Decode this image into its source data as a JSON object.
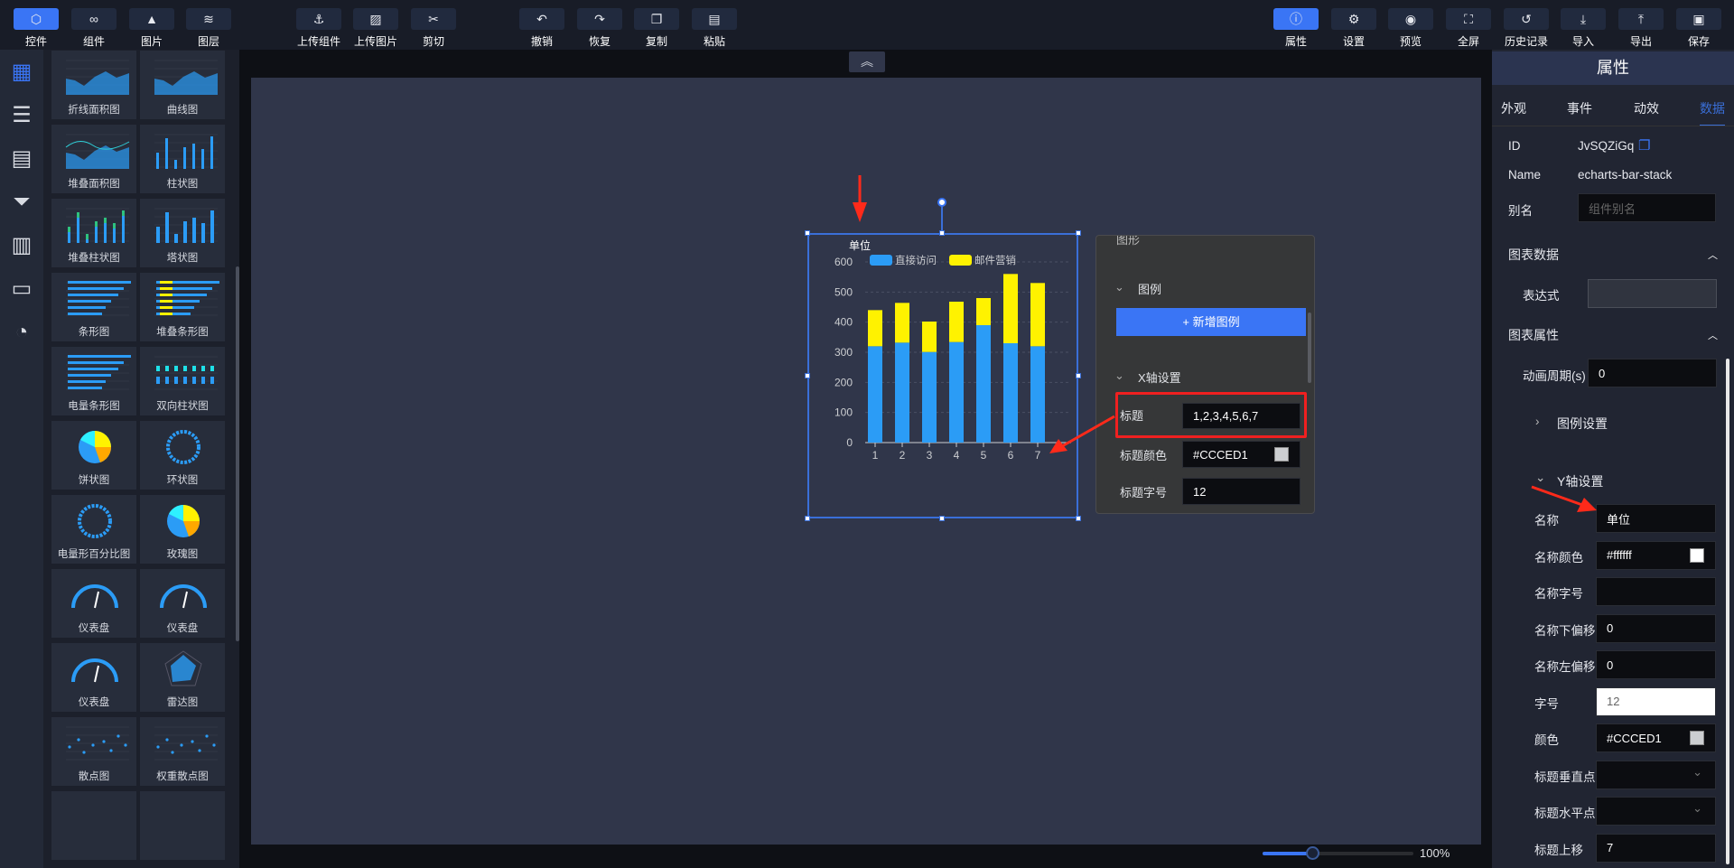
{
  "toolbar": {
    "left": [
      {
        "label": "控件",
        "icon": "⬡",
        "name": "controls",
        "active": true
      },
      {
        "label": "组件",
        "icon": "∞",
        "name": "components"
      },
      {
        "label": "图片",
        "icon": "▲",
        "name": "images"
      },
      {
        "label": "图层",
        "icon": "≋",
        "name": "layers"
      },
      {
        "label": "上传组件",
        "icon": "⚓",
        "name": "upload-component"
      },
      {
        "label": "上传图片",
        "icon": "▨",
        "name": "upload-image"
      },
      {
        "label": "剪切",
        "icon": "✂",
        "name": "cut"
      },
      {
        "label": "撤销",
        "icon": "↶",
        "name": "undo"
      },
      {
        "label": "恢复",
        "icon": "↷",
        "name": "redo"
      },
      {
        "label": "复制",
        "icon": "❐",
        "name": "copy"
      },
      {
        "label": "粘贴",
        "icon": "▤",
        "name": "paste"
      }
    ],
    "right": [
      {
        "label": "属性",
        "icon": "ⓘ",
        "name": "properties",
        "active": true
      },
      {
        "label": "设置",
        "icon": "⚙",
        "name": "settings"
      },
      {
        "label": "预览",
        "icon": "◉",
        "name": "preview"
      },
      {
        "label": "全屏",
        "icon": "⛶",
        "name": "fullscreen"
      },
      {
        "label": "历史记录",
        "icon": "↺",
        "name": "history"
      },
      {
        "label": "导入",
        "icon": "⤓",
        "name": "import"
      },
      {
        "label": "导出",
        "icon": "⤒",
        "name": "export"
      },
      {
        "label": "保存",
        "icon": "▣",
        "name": "save"
      }
    ]
  },
  "rail": [
    {
      "icon": "▦",
      "name": "grid"
    },
    {
      "icon": "☰",
      "name": "sliders"
    },
    {
      "icon": "▤",
      "name": "table"
    },
    {
      "icon": "⏷",
      "name": "filter"
    },
    {
      "icon": "▥",
      "name": "bar-chart"
    },
    {
      "icon": "▭",
      "name": "video"
    },
    {
      "icon": "◔",
      "name": "pie-chart"
    }
  ],
  "components": [
    {
      "label": "折线面积图",
      "kind": "area"
    },
    {
      "label": "曲线图",
      "kind": "area"
    },
    {
      "label": "堆叠面积图",
      "kind": "area2"
    },
    {
      "label": "柱状图",
      "kind": "bar"
    },
    {
      "label": "堆叠柱状图",
      "kind": "stackbar"
    },
    {
      "label": "塔状图",
      "kind": "tower"
    },
    {
      "label": "条形图",
      "kind": "hbar"
    },
    {
      "label": "堆叠条形图",
      "kind": "hstack"
    },
    {
      "label": "电量条形图",
      "kind": "hbar"
    },
    {
      "label": "双向柱状图",
      "kind": "bibar"
    },
    {
      "label": "饼状图",
      "kind": "pie"
    },
    {
      "label": "环状图",
      "kind": "ring"
    },
    {
      "label": "电量形百分比图",
      "kind": "ring"
    },
    {
      "label": "玫瑰图",
      "kind": "pie"
    },
    {
      "label": "仪表盘",
      "kind": "gauge"
    },
    {
      "label": "仪表盘",
      "kind": "gauge"
    },
    {
      "label": "仪表盘",
      "kind": "gauge"
    },
    {
      "label": "雷达图",
      "kind": "radar"
    },
    {
      "label": "散点图",
      "kind": "scatter"
    },
    {
      "label": "权重散点图",
      "kind": "scatter"
    },
    {
      "label": "",
      "kind": "none"
    },
    {
      "label": "",
      "kind": "none"
    }
  ],
  "canvas": {
    "collapse_icon": "︽"
  },
  "chart_data": {
    "type": "bar",
    "stacked": true,
    "ylabel": "单位",
    "categories": [
      "1",
      "2",
      "3",
      "4",
      "5",
      "6",
      "7"
    ],
    "ylim": [
      0,
      600
    ],
    "yticks": [
      "0",
      "100",
      "200",
      "300",
      "400",
      "500",
      "600"
    ],
    "series": [
      {
        "name": "直接访问",
        "color": "#2b9cf6",
        "values": [
          320,
          332,
          301,
          334,
          390,
          330,
          320
        ]
      },
      {
        "name": "邮件营销",
        "color": "#fff200",
        "values": [
          120,
          132,
          101,
          134,
          90,
          230,
          210
        ]
      }
    ]
  },
  "float_panel": {
    "top_cut": "图形",
    "legend_section": "图例",
    "add_legend": "+ 新增图例",
    "xaxis_section": "X轴设置",
    "title_label": "标题",
    "title_value": "1,2,3,4,5,6,7",
    "title_color_label": "标题颜色",
    "title_color_value": "#CCCED1",
    "title_size_label": "标题字号",
    "title_size_value": "12"
  },
  "props": {
    "header": "属性",
    "tabs": [
      "外观",
      "事件",
      "动效",
      "数据"
    ],
    "id_label": "ID",
    "id_value": "JvSQZiGq",
    "name_label": "Name",
    "name_value": "echarts-bar-stack",
    "alias_label": "别名",
    "alias_placeholder": "组件别名",
    "chart_data_section": "图表数据",
    "expr_label": "表达式",
    "chart_props_section": "图表属性",
    "anim_label": "动画周期(s)",
    "anim_value": "0",
    "legend_settings": "图例设置",
    "yaxis_section": "Y轴设置",
    "rows": [
      {
        "label": "名称",
        "value": "单位"
      },
      {
        "label": "名称颜色",
        "value": "#ffffff",
        "swatch": "#ffffff"
      },
      {
        "label": "名称字号",
        "value": ""
      },
      {
        "label": "名称下偏移",
        "value": "0"
      },
      {
        "label": "名称左偏移",
        "value": "0"
      },
      {
        "label": "字号",
        "value": "12",
        "white": true
      },
      {
        "label": "颜色",
        "value": "#CCCED1",
        "swatch": "#CCCED1"
      },
      {
        "label": "标题垂直点",
        "value": "",
        "select": true
      },
      {
        "label": "标题水平点",
        "value": "",
        "select": true
      },
      {
        "label": "标题上移",
        "value": "7"
      }
    ]
  },
  "zoom": {
    "label": "100%",
    "value": 0.33
  }
}
